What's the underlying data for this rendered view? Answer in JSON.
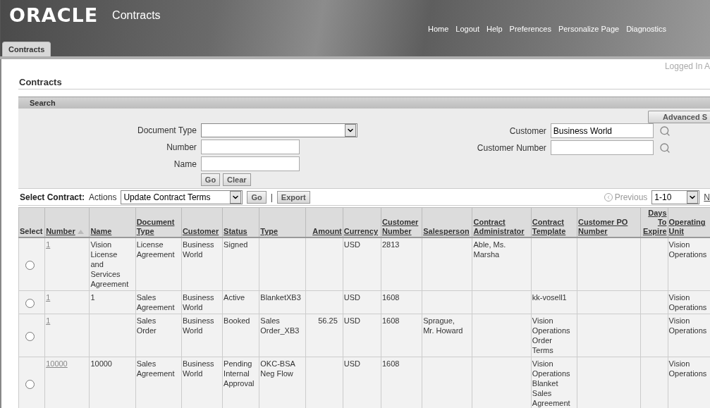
{
  "header": {
    "logo": "ORACLE",
    "app_title": "Contracts",
    "global_links": [
      "Home",
      "Logout",
      "Help",
      "Preferences",
      "Personalize Page",
      "Diagnostics"
    ],
    "tabs": [
      {
        "label": "Contracts",
        "selected": true
      }
    ],
    "logged_in": "Logged In A"
  },
  "page_title": "Contracts",
  "search": {
    "title": "Search",
    "advanced_button": "Advanced S",
    "left_fields": [
      {
        "label": "Document Type",
        "kind": "select"
      },
      {
        "label": "Number",
        "kind": "text"
      },
      {
        "label": "Name",
        "kind": "text"
      }
    ],
    "right_fields": [
      {
        "label": "Customer",
        "kind": "lookup",
        "value": "Business World"
      },
      {
        "label": "Customer Number",
        "kind": "lookup"
      }
    ],
    "buttons": [
      "Go",
      "Clear"
    ]
  },
  "toolbar": {
    "label": "Select Contract:",
    "actions_label": "Actions",
    "action_value": "Update Contract Terms",
    "go": "Go",
    "separator": "|",
    "export": "Export",
    "previous": "Previous",
    "range": "1-10",
    "next": "N"
  },
  "table": {
    "columns": [
      {
        "label": "Select",
        "kind": "radio",
        "sorted": false
      },
      {
        "label": "Number",
        "kind": "link",
        "sorted": true
      },
      {
        "label": "Name",
        "kind": "text",
        "sorted": false
      },
      {
        "label": "Document Type",
        "kind": "text",
        "sorted": false
      },
      {
        "label": "Customer",
        "kind": "text",
        "sorted": false
      },
      {
        "label": "Status",
        "kind": "text",
        "sorted": false
      },
      {
        "label": "Type",
        "kind": "text",
        "sorted": false
      },
      {
        "label": "Amount",
        "kind": "amount",
        "sorted": false
      },
      {
        "label": "Currency",
        "kind": "text",
        "sorted": false
      },
      {
        "label": "Customer Number",
        "kind": "text",
        "sorted": false
      },
      {
        "label": "Salesperson",
        "kind": "text",
        "sorted": false
      },
      {
        "label": "Contract Administrator",
        "kind": "text",
        "sorted": false
      },
      {
        "label": "Contract Template",
        "kind": "text",
        "sorted": false
      },
      {
        "label": "Customer PO Number",
        "kind": "text",
        "sorted": false
      },
      {
        "label": "Days To Expire",
        "kind": "amount",
        "sorted": false
      },
      {
        "label": "Operating Unit",
        "kind": "text",
        "sorted": false
      }
    ],
    "rows": [
      {
        "selected": false,
        "cells": [
          "",
          "1",
          "Vision License and Services Agreement",
          "License Agreement",
          "Business World",
          "Signed",
          "",
          "",
          "USD",
          "2813",
          "",
          "Able, Ms. Marsha",
          "",
          "",
          "",
          "Vision Operations"
        ]
      },
      {
        "selected": false,
        "cells": [
          "",
          "1",
          "1",
          "Sales Agreement",
          "Business World",
          "Active",
          "BlanketXB3",
          "",
          "USD",
          "1608",
          "",
          "",
          "kk-vosell1",
          "",
          "",
          "Vision Operations"
        ]
      },
      {
        "selected": false,
        "cells": [
          "",
          "1",
          "",
          "Sales Order",
          "Business World",
          "Booked",
          "Sales Order_XB3",
          "56.25",
          "USD",
          "1608",
          "Sprague, Mr. Howard",
          "",
          "Vision Operations Order Terms",
          "",
          "",
          "Vision Operations"
        ]
      },
      {
        "selected": false,
        "cells": [
          "",
          "10000",
          "10000",
          "Sales Agreement",
          "Business World",
          "Pending Internal Approval",
          "OKC-BSA Neg Flow",
          "",
          "USD",
          "1608",
          "",
          "",
          "Vision Operations Blanket Sales Agreement",
          "",
          "",
          "Vision Operations"
        ]
      }
    ]
  }
}
